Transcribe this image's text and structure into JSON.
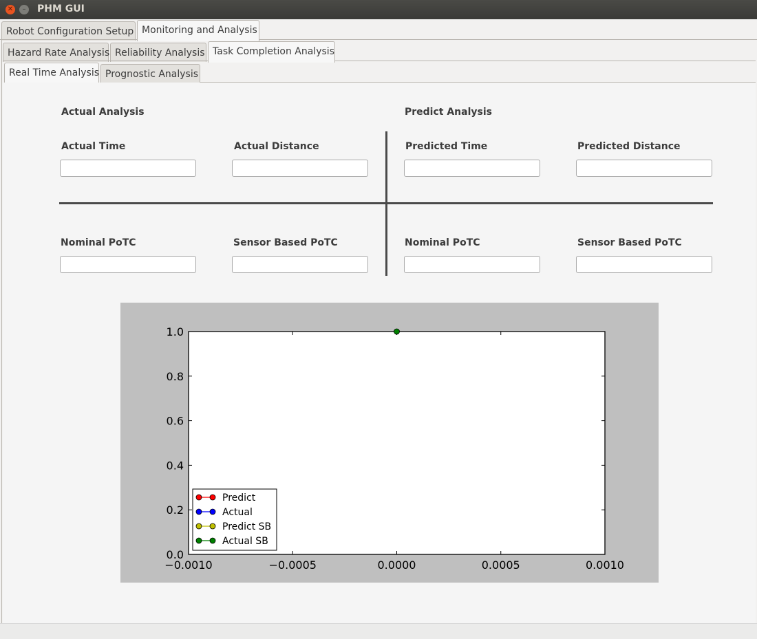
{
  "window": {
    "title": "PHM GUI"
  },
  "tabs_level1": [
    "Robot Configuration Setup",
    "Monitoring and Analysis"
  ],
  "tabs_level2": [
    "Hazard Rate Analysis",
    "Reliability Analysis",
    "Task Completion Analysis"
  ],
  "tabs_level3": [
    "Real Time Analysis",
    "Prognostic Analysis"
  ],
  "actual": {
    "heading": "Actual Analysis",
    "time_label": "Actual Time",
    "time_value": "",
    "distance_label": "Actual Distance",
    "distance_value": "",
    "nominal_label": "Nominal PoTC",
    "nominal_value": "",
    "sensor_label": "Sensor Based PoTC",
    "sensor_value": ""
  },
  "predict": {
    "heading": "Predict Analysis",
    "time_label": "Predicted Time",
    "time_value": "",
    "distance_label": "Predicted Distance",
    "distance_value": "",
    "nominal_label": "Nominal PoTC",
    "nominal_value": "",
    "sensor_label": "Sensor Based PoTC",
    "sensor_value": ""
  },
  "chart_data": {
    "type": "line",
    "xlim": [
      -0.001,
      0.001
    ],
    "ylim": [
      0.0,
      1.0
    ],
    "xticks": [
      "−0.0010",
      "−0.0005",
      "0.0000",
      "0.0005",
      "0.0010"
    ],
    "xtick_values": [
      -0.001,
      -0.0005,
      0.0,
      0.0005,
      0.001
    ],
    "yticks": [
      "0.0",
      "0.2",
      "0.4",
      "0.6",
      "0.8",
      "1.0"
    ],
    "ytick_values": [
      0.0,
      0.2,
      0.4,
      0.6,
      0.8,
      1.0
    ],
    "legend_position": "bottom-left",
    "series": [
      {
        "name": "Predict",
        "color": "#ff0000",
        "x": [],
        "y": []
      },
      {
        "name": "Actual",
        "color": "#0000ff",
        "x": [],
        "y": []
      },
      {
        "name": "Predict SB",
        "color": "#bfbf00",
        "x": [],
        "y": []
      },
      {
        "name": "Actual SB",
        "color": "#008000",
        "x": [
          0.0
        ],
        "y": [
          1.0
        ]
      }
    ]
  }
}
